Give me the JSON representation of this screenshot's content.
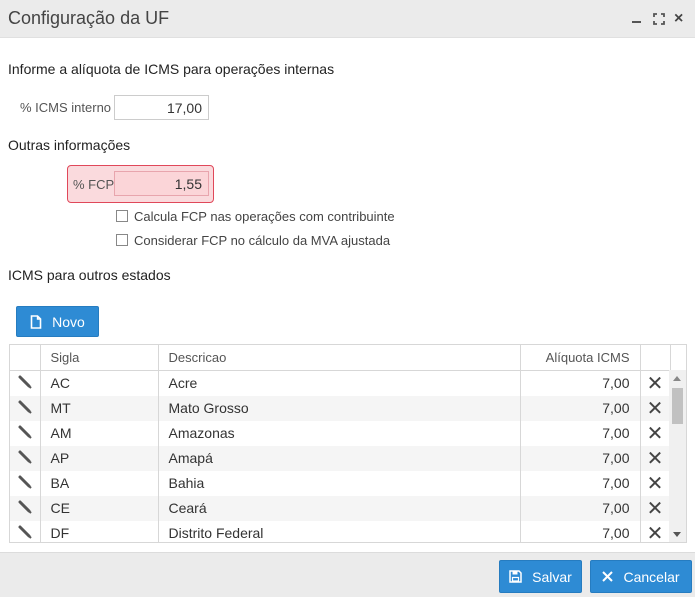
{
  "window": {
    "title": "Configuração da UF",
    "close_glyph": "×"
  },
  "internal": {
    "heading": "Informe a alíquota de ICMS para operações internas",
    "icms_label": "% ICMS interno",
    "icms_value": "17,00"
  },
  "other": {
    "heading": "Outras informações",
    "fcp_label": "% FCP",
    "fcp_value": "1,55",
    "check_fcp_contrib": "Calcula FCP nas operações com contribuinte",
    "check_fcp_mva": "Considerar FCP no cálculo da MVA ajustada"
  },
  "states": {
    "heading": "ICMS para outros estados",
    "new_label": "Novo",
    "columns": {
      "sigla": "Sigla",
      "descricao": "Descricao",
      "aliquota": "Alíquota ICMS"
    },
    "rows": [
      {
        "sigla": "AC",
        "descricao": "Acre",
        "aliquota": "7,00"
      },
      {
        "sigla": "MT",
        "descricao": "Mato Grosso",
        "aliquota": "7,00"
      },
      {
        "sigla": "AM",
        "descricao": "Amazonas",
        "aliquota": "7,00"
      },
      {
        "sigla": "AP",
        "descricao": "Amapá",
        "aliquota": "7,00"
      },
      {
        "sigla": "BA",
        "descricao": "Bahia",
        "aliquota": "7,00"
      },
      {
        "sigla": "CE",
        "descricao": "Ceará",
        "aliquota": "7,00"
      },
      {
        "sigla": "DF",
        "descricao": "Distrito Federal",
        "aliquota": "7,00"
      }
    ],
    "delete_glyph": "✕"
  },
  "footer": {
    "save_label": "Salvar",
    "cancel_label": "Cancelar"
  },
  "colors": {
    "accent": "#2e8bd4",
    "error_border": "#e0485a",
    "error_fill": "#fadadd"
  },
  "icons": [
    "minimize-icon",
    "maximize-icon",
    "close-icon",
    "file-icon",
    "pencil-icon",
    "delete-icon",
    "save-icon",
    "cancel-icon"
  ]
}
